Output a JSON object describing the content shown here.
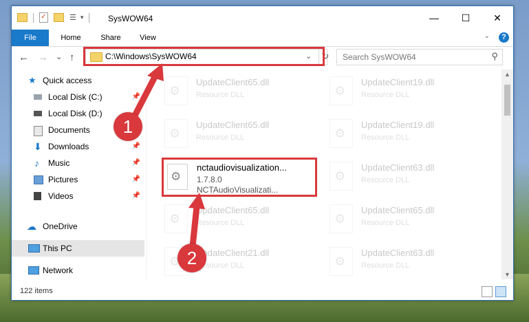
{
  "window": {
    "title": "SysWOW64",
    "controls": {
      "minimize": "—",
      "maximize": "☐",
      "close": "✕"
    }
  },
  "ribbon": {
    "tabs": [
      "File",
      "Home",
      "Share",
      "View"
    ]
  },
  "nav": {
    "back": "←",
    "forward": "→",
    "recent": "⌄",
    "up": "↑",
    "address": "C:\\Windows\\SysWOW64",
    "search_placeholder": "Search SysWOW64"
  },
  "sidebar": {
    "items": [
      {
        "label": "Quick access",
        "icon": "star-icon"
      },
      {
        "label": "Local Disk (C:)",
        "icon": "drive-icon"
      },
      {
        "label": "Local Disk (D:)",
        "icon": "drive-icon"
      },
      {
        "label": "Documents",
        "icon": "documents-icon"
      },
      {
        "label": "Downloads",
        "icon": "download-icon"
      },
      {
        "label": "Music",
        "icon": "music-icon"
      },
      {
        "label": "Pictures",
        "icon": "pictures-icon"
      },
      {
        "label": "Videos",
        "icon": "videos-icon"
      },
      {
        "label": "OneDrive",
        "icon": "cloud-icon"
      },
      {
        "label": "This PC",
        "icon": "computer-icon"
      },
      {
        "label": "Network",
        "icon": "network-icon"
      }
    ]
  },
  "files": [
    {
      "name": "UpdateClient65.dll",
      "type": "Resource DLL"
    },
    {
      "name": "UpdateClient19.dll",
      "type": "Resource DLL"
    },
    {
      "name": "UpdateClient65.dll",
      "type": "Resource DLL"
    },
    {
      "name": "UpdateClient19.dll",
      "type": "Resource DLL"
    },
    {
      "name": "UpdateClient63.dll",
      "type": "Resource DLL"
    },
    {
      "name": "UpdateClient65.dll",
      "type": "Resource DLL"
    },
    {
      "name": "UpdateClient65.dll",
      "type": "Resource DLL"
    },
    {
      "name": "UpdateClient21.dll",
      "type": "Resource DLL"
    },
    {
      "name": "UpdateClient63.dll",
      "type": "Resource DLL"
    }
  ],
  "highlighted_file": {
    "name": "nctaudiovisualization...",
    "version": "1.7.8.0",
    "description": "NCTAudioVisualizati..."
  },
  "status": {
    "items": "122 items"
  },
  "callouts": [
    "1",
    "2"
  ],
  "colors": {
    "accent": "#1979ca",
    "highlight": "#d9383c"
  }
}
